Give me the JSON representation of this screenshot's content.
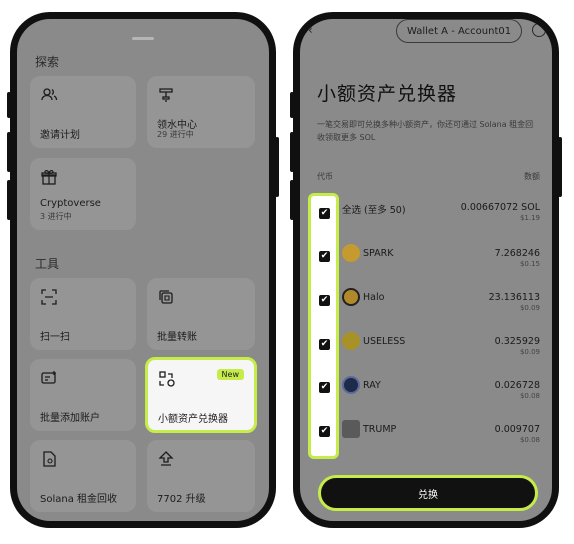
{
  "left": {
    "explore_title": "探索",
    "explore_cards": [
      {
        "title": "邀请计划",
        "sub": ""
      },
      {
        "title": "领水中心",
        "sub": "29 进行中"
      },
      {
        "title": "Cryptoverse",
        "sub": "3 进行中"
      }
    ],
    "tools_title": "工具",
    "tool_cards": [
      {
        "title": "扫一扫"
      },
      {
        "title": "批量转账"
      },
      {
        "title": "批量添加账户"
      },
      {
        "title": "小额资产兑换器",
        "badge": "New"
      },
      {
        "title": "Solana 租金回收"
      },
      {
        "title": "7702 升级"
      }
    ]
  },
  "right": {
    "wallet_pill": "Wallet A - Account01",
    "title": "小额资产兑换器",
    "description": "一笔交易即可兑换多种小额资产，你还可通过 Solana 租金回收领取更多 SOL",
    "col_token": "代币",
    "col_amount": "数额",
    "rows": [
      {
        "name": "全选 (至多 50)",
        "amount": "0.00667072 SOL",
        "usd": "$1.19",
        "checked": true
      },
      {
        "name": "SPARK",
        "amount": "7.268246",
        "usd": "$0.15",
        "checked": true
      },
      {
        "name": "Halo",
        "amount": "23.136113",
        "usd": "$0.09",
        "checked": true
      },
      {
        "name": "USELESS",
        "amount": "0.325929",
        "usd": "$0.09",
        "checked": true
      },
      {
        "name": "RAY",
        "amount": "0.026728",
        "usd": "$0.08",
        "checked": true
      },
      {
        "name": "TRUMP",
        "amount": "0.009707",
        "usd": "$0.08",
        "checked": true
      }
    ],
    "swap_button": "兑换"
  },
  "colors": {
    "accent": "#c6ec49",
    "overlay": "#8a8a8a",
    "dark": "#111111"
  }
}
